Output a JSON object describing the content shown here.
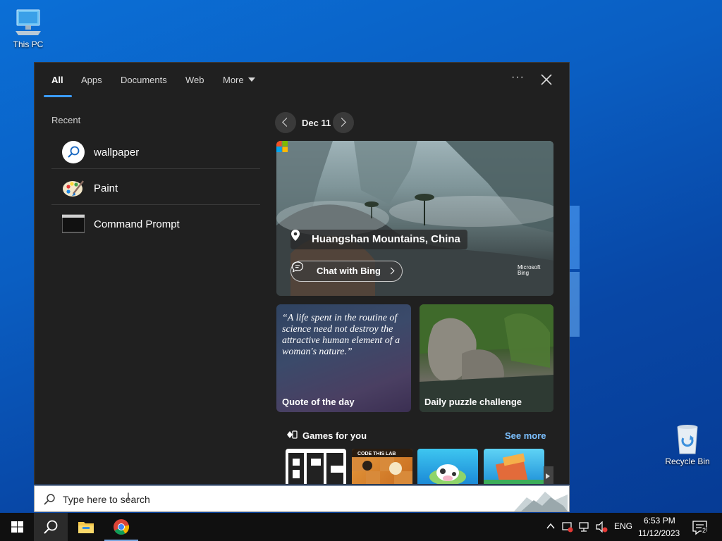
{
  "desktop": {
    "icons": [
      {
        "label": "This PC"
      },
      {
        "label": "Recycle Bin"
      }
    ]
  },
  "search_panel": {
    "tabs": [
      {
        "label": "All",
        "active": true
      },
      {
        "label": "Apps"
      },
      {
        "label": "Documents"
      },
      {
        "label": "Web"
      },
      {
        "label": "More"
      }
    ],
    "recent": {
      "heading": "Recent",
      "items": [
        {
          "label": "wallpaper",
          "icon": "search-icon"
        },
        {
          "label": "Paint",
          "icon": "paint-icon"
        },
        {
          "label": "Command Prompt",
          "icon": "command-prompt-icon"
        }
      ]
    },
    "highlights": {
      "date": "Dec 11",
      "hero": {
        "location": "Huangshan Mountains, China",
        "chat_label": "Chat with Bing",
        "brand_line1": "Microsoft",
        "brand_line2": "Bing"
      },
      "quote": {
        "text": "“A life spent in the routine of science need not destroy the attractive human element of a woman's nature.”",
        "label": "Quote of the day"
      },
      "puzzle": {
        "label": "Daily puzzle challenge"
      },
      "games": {
        "title": "Games for you",
        "see_more": "See more",
        "g2_text": "CODE THIS LAB"
      }
    }
  },
  "search_box": {
    "placeholder": "Type here to search"
  },
  "taskbar": {
    "tray": {
      "language": "ENG",
      "time": "6:53 PM",
      "date": "11/12/2023",
      "notification_count": "2"
    }
  },
  "colors": {
    "accent": "#3b9cff",
    "panel_bg": "#202020",
    "see_more": "#7cc0ff",
    "taskbar": "#101010"
  }
}
